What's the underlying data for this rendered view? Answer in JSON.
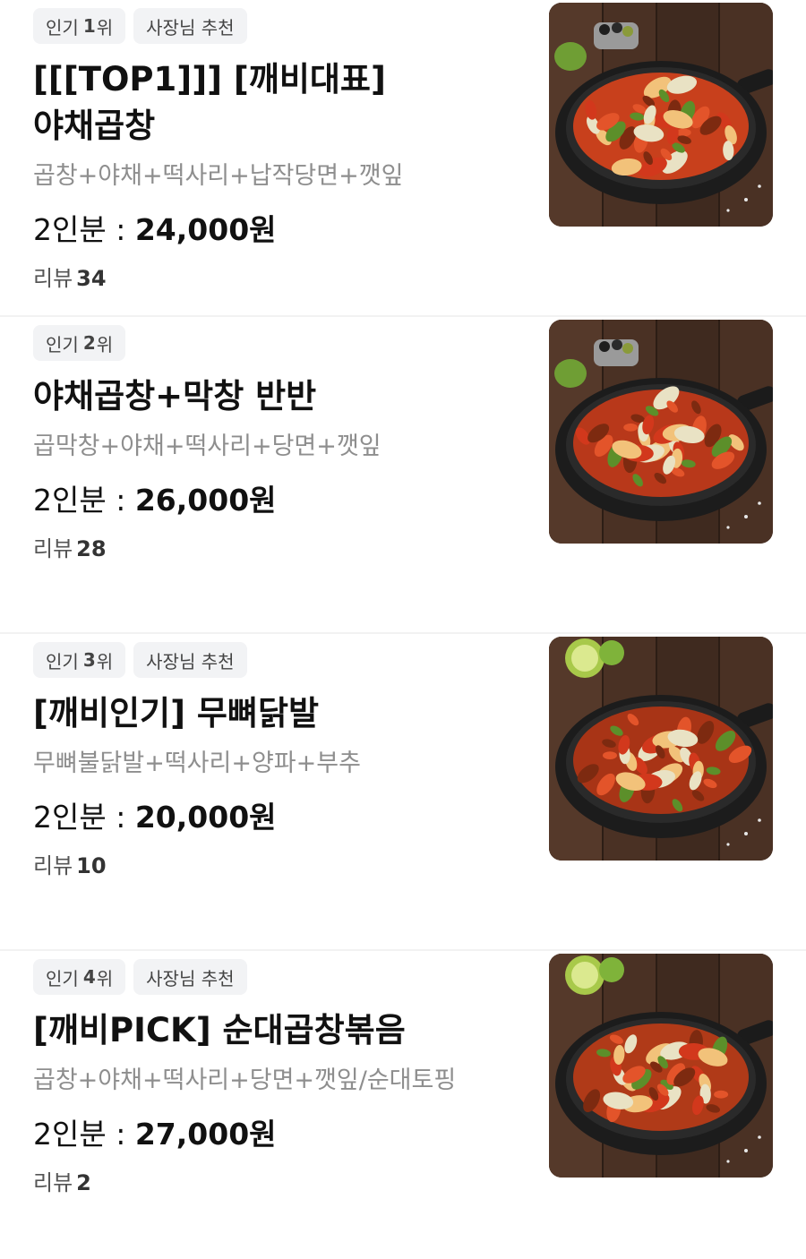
{
  "menu": {
    "items": [
      {
        "rank_label": "인기",
        "rank_num": "1",
        "rank_suffix": "위",
        "recommend": "사장님 추천",
        "name": "[[[TOP1]]] [깨비대표] 야채곱창",
        "desc": "곱창+야채+떡사리+납작당면+깻잎",
        "serving": "2인분 : ",
        "price": "24,000원",
        "review_label": "리뷰",
        "review_count": "34",
        "image_alt": "야채곱창 food photo"
      },
      {
        "rank_label": "인기",
        "rank_num": "2",
        "rank_suffix": "위",
        "recommend": "",
        "name": "야채곱창+막창 반반",
        "desc": "곱막창+야채+떡사리+당면+깻잎",
        "serving": "2인분 : ",
        "price": "26,000원",
        "review_label": "리뷰",
        "review_count": "28",
        "image_alt": "야채곱창+막창 food photo"
      },
      {
        "rank_label": "인기",
        "rank_num": "3",
        "rank_suffix": "위",
        "recommend": "사장님 추천",
        "name": "[깨비인기] 무뼈닭발",
        "desc": "무뼈불닭발+떡사리+양파+부추",
        "serving": "2인분 : ",
        "price": "20,000원",
        "review_label": "리뷰",
        "review_count": "10",
        "image_alt": "무뼈닭발 food photo"
      },
      {
        "rank_label": "인기",
        "rank_num": "4",
        "rank_suffix": "위",
        "recommend": "사장님 추천",
        "name": "[깨비PICK] 순대곱창볶음",
        "desc": "곱창+야채+떡사리+당면+깻잎/순대토핑",
        "serving": "2인분 : ",
        "price": "27,000원",
        "review_label": "리뷰",
        "review_count": "2",
        "image_alt": "순대곱창볶음 food photo"
      }
    ]
  },
  "colors": {
    "badge_bg": "#f2f3f5",
    "desc_text": "#8e8e8e",
    "divider": "#f2f2f2"
  }
}
